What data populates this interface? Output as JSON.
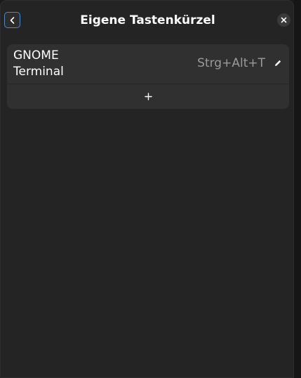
{
  "window": {
    "title": "Eigene Tastenkürzel"
  },
  "header": {
    "back_icon": "chevron-left-icon",
    "close_icon": "close-icon"
  },
  "shortcuts": [
    {
      "name_line1": "GNOME",
      "name_line2": "Terminal",
      "accelerator": "Strg+Alt+T",
      "edit_icon": "pencil-icon"
    }
  ],
  "add_row": {
    "icon": "plus-icon"
  },
  "colors": {
    "background": "#242424",
    "card": "#303030",
    "accent": "#4f88c9",
    "text": "#ffffff",
    "dim_text": "#9a9a9a"
  }
}
